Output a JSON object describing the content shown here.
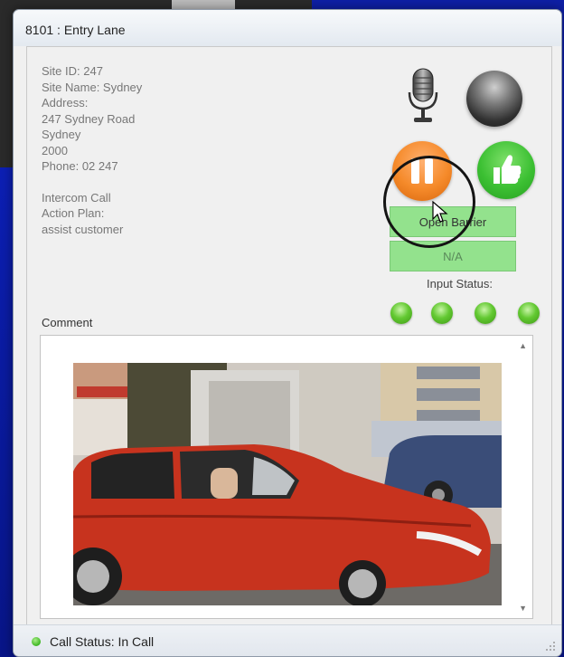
{
  "window": {
    "title": "8101 : Entry Lane"
  },
  "site_info": {
    "site_id": "Site ID: 247",
    "site_name": "Site Name: Sydney",
    "address_label": "Address:",
    "address_line1": "247 Sydney Road",
    "address_line2": "Sydney",
    "address_line3": "2000",
    "phone": "Phone: 02 247",
    "call_type": "Intercom Call",
    "action_plan_label": "Action Plan:",
    "action_plan": "assist customer"
  },
  "controls": {
    "open_barrier_label": "Open Barrier",
    "na_label": "N/A",
    "input_status_label": "Input Status:",
    "input_leds": [
      "on",
      "on",
      "on",
      "on"
    ]
  },
  "comment": {
    "label": "Comment"
  },
  "status_bar": {
    "text": "Call Status: In Call"
  },
  "icons": {
    "microphone": "microphone-icon",
    "record_led": "record-indicator-icon",
    "pause": "pause-icon",
    "accept": "thumbs-up-icon",
    "cursor": "mouse-pointer-icon"
  },
  "colors": {
    "pause_orange": "#f58a2a",
    "accept_green": "#3cc033",
    "button_green": "#93e28d",
    "led_green": "#63c932",
    "desktop_blue": "#0c1fb4"
  }
}
